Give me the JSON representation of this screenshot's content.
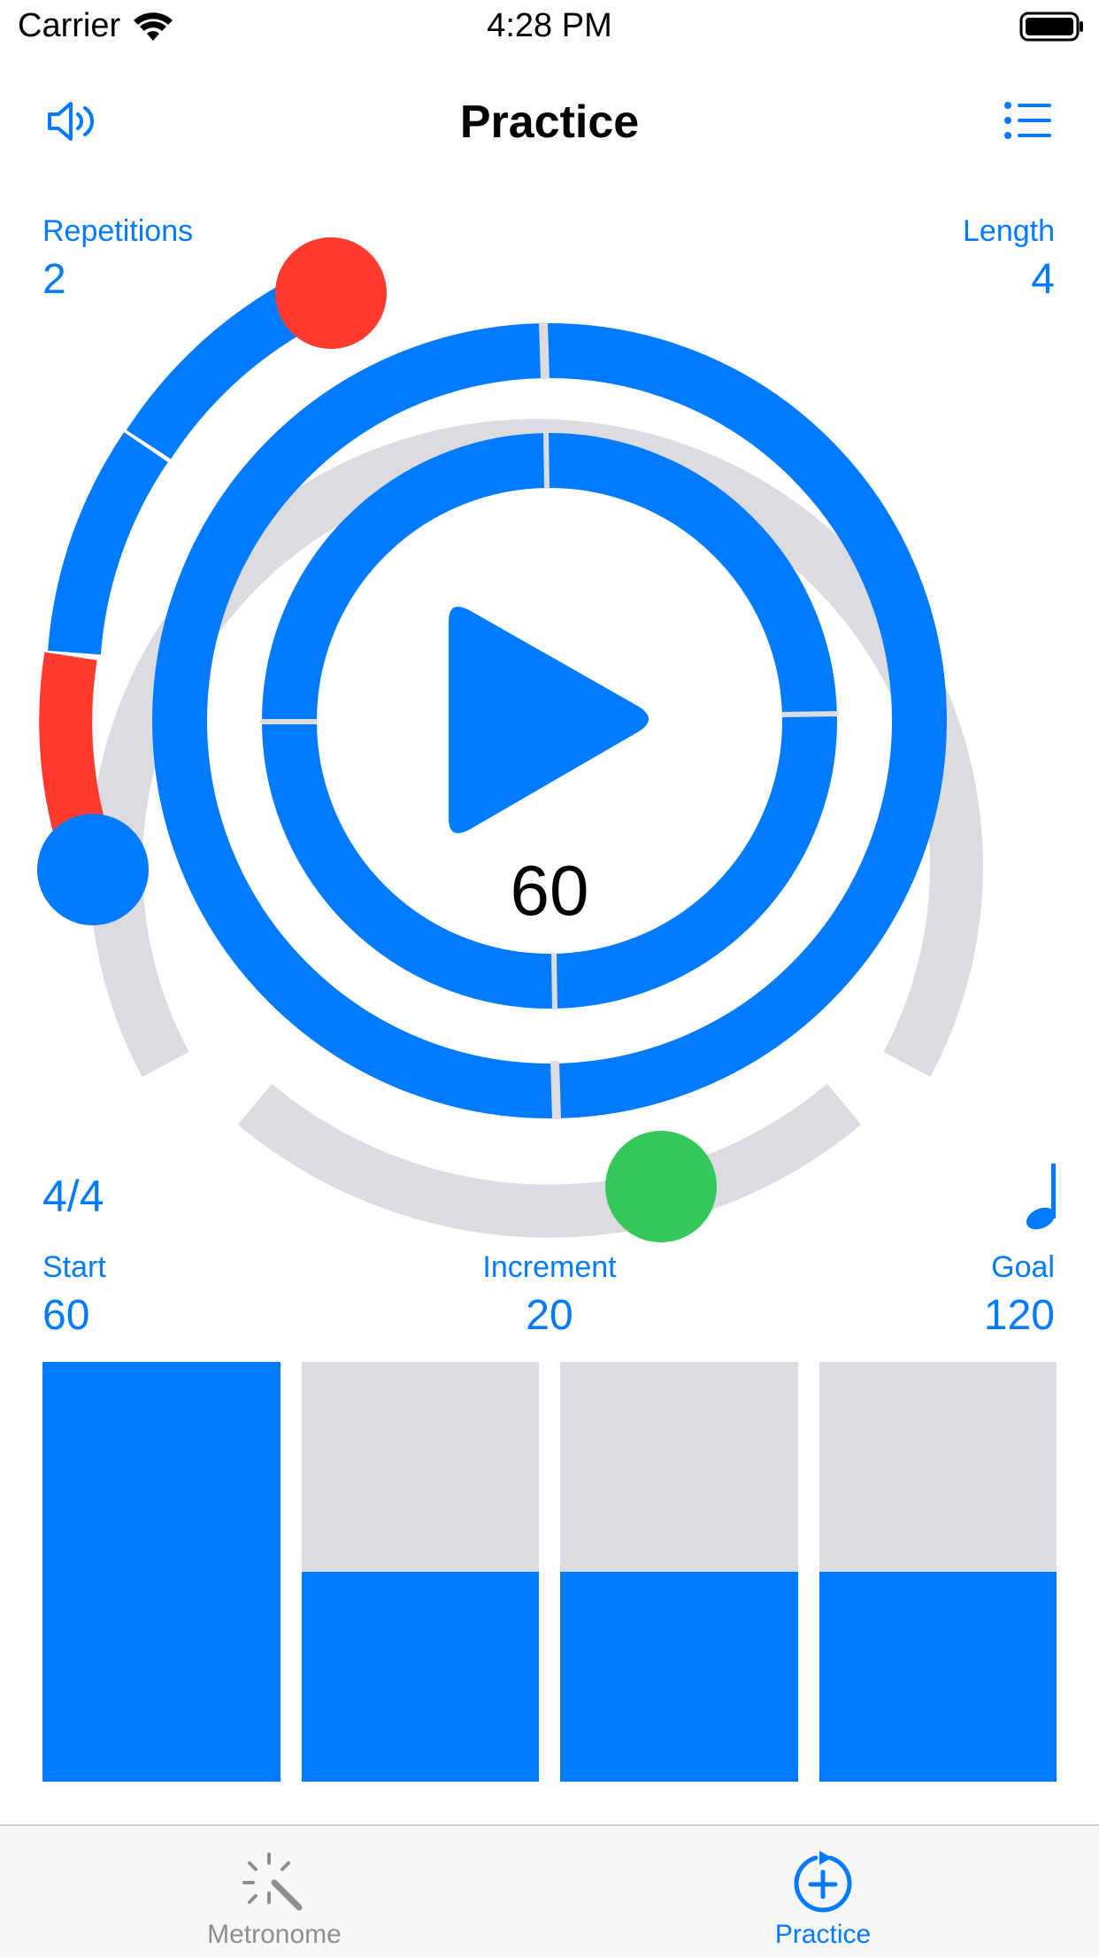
{
  "status_bar": {
    "carrier": "Carrier",
    "time": "4:28 PM",
    "icons": [
      "wifi-icon",
      "battery-icon"
    ]
  },
  "nav": {
    "title": "Practice",
    "left_icon": "speaker-icon",
    "right_icon": "list-icon"
  },
  "practice": {
    "repetitions_label": "Repetitions",
    "repetitions_value": "2",
    "length_label": "Length",
    "length_value": "4",
    "tempo": "60",
    "play_icon": "play-icon",
    "time_signature": "4/4",
    "note_icon": "quarter-note-icon",
    "start_label": "Start",
    "start_value": "60",
    "increment_label": "Increment",
    "increment_value": "20",
    "goal_label": "Goal",
    "goal_value": "120",
    "bars_fill": [
      1.0,
      0.5,
      0.5,
      0.5
    ]
  },
  "colors": {
    "accent": "#007aff",
    "track": "#dcdce0",
    "red": "#ff3b30",
    "green": "#34c759"
  },
  "tabs": [
    {
      "label": "Metronome",
      "icon": "magic-wand-icon",
      "selected": false
    },
    {
      "label": "Practice",
      "icon": "add-cycle-icon",
      "selected": true
    }
  ]
}
